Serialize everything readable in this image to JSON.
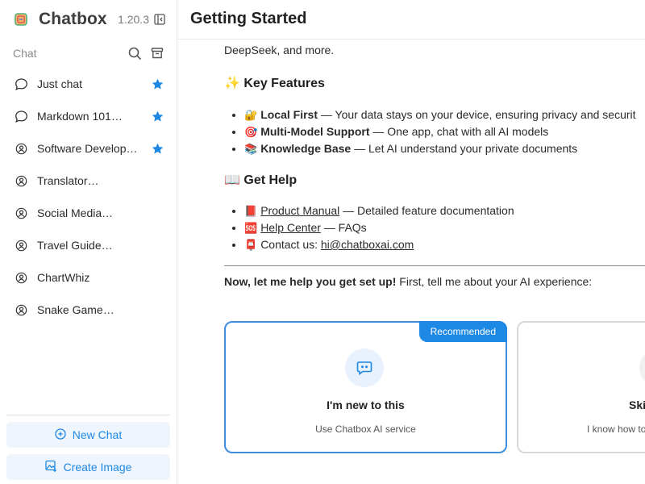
{
  "app": {
    "name": "Chatbox",
    "version": "1.20.3",
    "accent_color": "#1e88e5"
  },
  "sidebar": {
    "section_label": "Chat",
    "sessions": [
      {
        "label": "Just chat",
        "icon": "chat-bubble-icon",
        "starred": true
      },
      {
        "label": "Markdown 101…",
        "icon": "chat-bubble-icon",
        "starred": true
      },
      {
        "label": "Software Develop…",
        "icon": "user-circle-icon",
        "starred": true
      },
      {
        "label": "Translator…",
        "icon": "user-circle-icon",
        "starred": false
      },
      {
        "label": "Social Media…",
        "icon": "user-circle-icon",
        "starred": false
      },
      {
        "label": "Travel Guide…",
        "icon": "user-circle-icon",
        "starred": false
      },
      {
        "label": "ChartWhiz",
        "icon": "user-circle-icon",
        "starred": false
      },
      {
        "label": "Snake Game…",
        "icon": "user-circle-icon",
        "starred": false
      }
    ],
    "new_chat_label": "New Chat",
    "create_image_label": "Create Image"
  },
  "main": {
    "title": "Getting Started",
    "intro_tail": "DeepSeek, and more.",
    "key_features": {
      "heading_emoji": "✨",
      "heading": "Key Features",
      "items": [
        {
          "emoji": "🔐",
          "title": "Local First",
          "text": " — Your data stays on your device, ensuring privacy and securit"
        },
        {
          "emoji": "🎯",
          "title": "Multi-Model Support",
          "text": " — One app, chat with all AI models"
        },
        {
          "emoji": "📚",
          "title": "Knowledge Base",
          "text": " — Let AI understand your private documents"
        }
      ]
    },
    "get_help": {
      "heading_emoji": "📖",
      "heading": "Get Help",
      "items": [
        {
          "emoji": "📕",
          "link": "Product Manual",
          "text": " — Detailed feature documentation"
        },
        {
          "emoji": "🆘",
          "link": "Help Center",
          "text": " — FAQs"
        },
        {
          "emoji": "📮",
          "prefix": "Contact us: ",
          "link": "hi@chatboxai.com",
          "text": ""
        }
      ]
    },
    "setup_bold": "Now, let me help you get set up!",
    "setup_text": " First, tell me about your AI experience:",
    "options": [
      {
        "badge": "Recommended",
        "title": "I'm new to this",
        "subtitle": "Use Chatbox AI service"
      },
      {
        "title": "Ski",
        "subtitle": "I know how to"
      }
    ]
  }
}
